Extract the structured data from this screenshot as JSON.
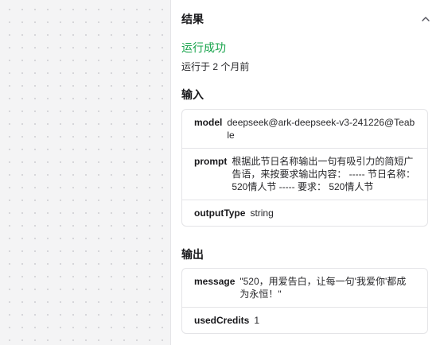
{
  "result": {
    "title": "结果",
    "status": "运行成功",
    "runtime": "运行于 2 个月前"
  },
  "input": {
    "title": "输入",
    "rows": [
      {
        "key": "model",
        "value": "deepseek@ark-deepseek-v3-241226@Teable"
      },
      {
        "key": "prompt",
        "value": "根据此节日名称输出一句有吸引力的简短广告语，来按要求输出内容： ----- 节日名称： 520情人节 ----- 要求： 520情人节"
      },
      {
        "key": "outputType",
        "value": "string"
      }
    ]
  },
  "output": {
    "title": "输出",
    "rows": [
      {
        "key": "message",
        "value": "\"520，用爱告白，让每一句'我爱你'都成为永恒！\""
      },
      {
        "key": "usedCredits",
        "value": "1"
      }
    ]
  },
  "icons": {
    "collapse": "chevron-up-icon"
  },
  "colors": {
    "success": "#16a34a",
    "border": "#e4e4e7",
    "canvas": "#f4f4f5"
  }
}
